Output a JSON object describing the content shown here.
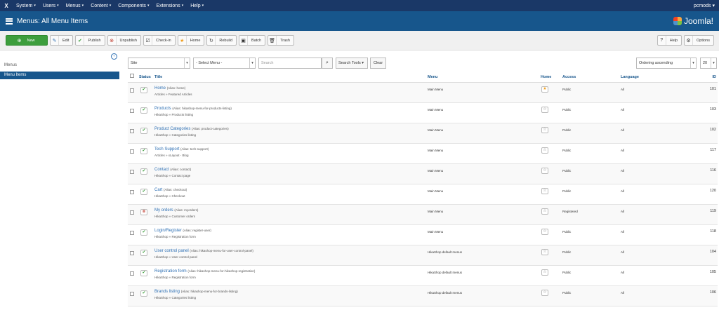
{
  "topbar": {
    "logo": "X",
    "menu": [
      "System",
      "Users",
      "Menus",
      "Content",
      "Components",
      "Extensions",
      "Help"
    ],
    "user": "pcmods"
  },
  "header": {
    "title": "Menus: All Menu Items",
    "brand": "Joomla!"
  },
  "toolbar": {
    "new": "New",
    "edit": "Edit",
    "publish": "Publish",
    "unpublish": "Unpublish",
    "checkin": "Check-in",
    "home": "Home",
    "rebuild": "Rebuild",
    "batch": "Batch",
    "trash": "Trash",
    "help": "Help",
    "options": "Options"
  },
  "sidebar": {
    "menus": "Menus",
    "menu_items": "Menu Items"
  },
  "filters": {
    "site": "Site",
    "select_menu": "- Select Menu -",
    "search_placeholder": "Search",
    "search_tools": "Search Tools",
    "clear": "Clear",
    "ordering": "Ordering ascending",
    "limit": "20"
  },
  "columns": {
    "status": "Status",
    "title": "Title",
    "menu": "Menu",
    "home": "Home",
    "access": "Access",
    "language": "Language",
    "id": "ID"
  },
  "rows": [
    {
      "title": "Home",
      "alias": "(Alias: home)",
      "sub": "Articles » Featured Articles",
      "menu": "Main Menu",
      "access": "Public",
      "language": "All",
      "id": "101"
    },
    {
      "title": "Products",
      "alias": "(Alias: hikashop-menu-for-products-listing)",
      "sub": "HikaShop » Products listing",
      "menu": "Main Menu",
      "access": "Public",
      "language": "All",
      "id": "103"
    },
    {
      "title": "Product Categories",
      "alias": "(Alias: product-categories)",
      "sub": "HikaShop » Categories listing",
      "menu": "Main Menu",
      "access": "Public",
      "language": "All",
      "id": "102"
    },
    {
      "title": "Tech Support",
      "alias": "(Alias: tech-support)",
      "sub": "Articles » xLayout - Blog",
      "menu": "Main Menu",
      "access": "Public",
      "language": "All",
      "id": "117"
    },
    {
      "title": "Contact",
      "alias": "(Alias: contact)",
      "sub": "HikaShop » Contact page",
      "menu": "Main Menu",
      "access": "Public",
      "language": "All",
      "id": "116"
    },
    {
      "title": "Cart",
      "alias": "(Alias: checkout)",
      "sub": "HikaShop » Checkout",
      "menu": "Main Menu",
      "access": "Public",
      "language": "All",
      "id": "120"
    },
    {
      "title": "My orders",
      "alias": "(Alias: myorders)",
      "sub": "HikaShop » Customer orders",
      "menu": "Main Menu",
      "access": "Registered",
      "language": "All",
      "id": "119"
    },
    {
      "title": "Login/Register",
      "alias": "(Alias: register-user)",
      "sub": "HikaShop » Registration form",
      "menu": "Main Menu",
      "access": "Public",
      "language": "All",
      "id": "118"
    },
    {
      "title": "User control panel",
      "alias": "(Alias: hikashop-menu-for-user-control-panel)",
      "sub": "HikaShop » User control panel",
      "menu": "HikaShop default menus",
      "access": "Public",
      "language": "All",
      "id": "104"
    },
    {
      "title": "Registration form",
      "alias": "(Alias: hikashop-menu-for-hikashop-registration)",
      "sub": "HikaShop » Registration form",
      "menu": "HikaShop default menus",
      "access": "Public",
      "language": "All",
      "id": "105"
    },
    {
      "title": "Brands listing",
      "alias": "(Alias: hikashop-menu-for-brands-listing)",
      "sub": "HikaShop » Categories listing",
      "menu": "HikaShop default menus",
      "access": "Public",
      "language": "All",
      "id": "106"
    }
  ],
  "colors": {
    "navbar": "#1a3867",
    "header": "#17568c",
    "new_button": "#3d9e3d",
    "link": "#2d6fb3"
  }
}
